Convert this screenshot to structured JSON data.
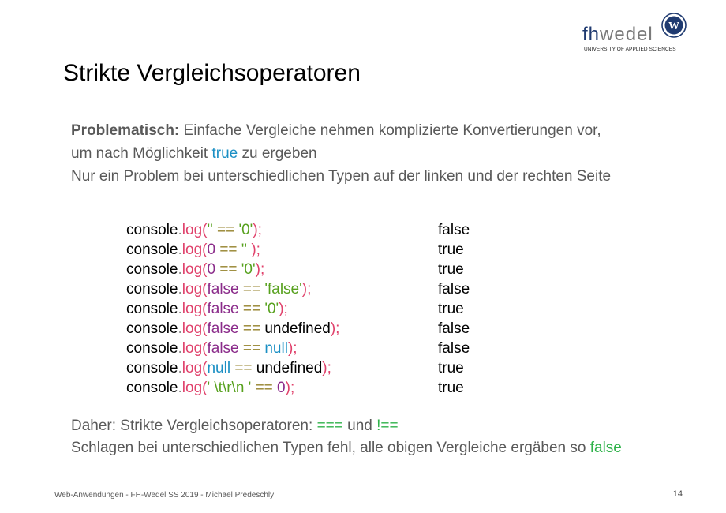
{
  "logo": {
    "fh": "fh",
    "wedel": "wedel",
    "subtitle": "UNIVERSITY OF APPLIED SCIENCES",
    "seal_letter": "W"
  },
  "slide": {
    "title": "Strikte Vergleichsoperatoren",
    "intro": {
      "label": "Problematisch:",
      "line1_text": " Einfache Vergleiche nehmen komplizierte Konvertierungen vor,",
      "line2_pre": "um nach Möglichkeit ",
      "line2_keyword": "true",
      "line2_post": " zu ergeben",
      "line3": "Nur ein Problem bei unterschiedlichen Typen auf der linken und der rechten Seite"
    },
    "code_lines": [
      {
        "tokens": [
          {
            "t": "console",
            "c": "k"
          },
          {
            "t": ".",
            "c": "e"
          },
          {
            "t": "log",
            "c": "m"
          },
          {
            "t": "(",
            "c": "m"
          },
          {
            "t": "''",
            "c": "s"
          },
          {
            "t": " == ",
            "c": "o"
          },
          {
            "t": "'0'",
            "c": "s"
          },
          {
            "t": ");",
            "c": "m"
          }
        ],
        "result": "false"
      },
      {
        "tokens": [
          {
            "t": "console",
            "c": "k"
          },
          {
            "t": ".",
            "c": "e"
          },
          {
            "t": "log",
            "c": "m"
          },
          {
            "t": "(",
            "c": "m"
          },
          {
            "t": "0",
            "c": "n"
          },
          {
            "t": " == ",
            "c": "o"
          },
          {
            "t": "''",
            "c": "s"
          },
          {
            "t": " );",
            "c": "m"
          }
        ],
        "result": "true"
      },
      {
        "tokens": [
          {
            "t": "console",
            "c": "k"
          },
          {
            "t": ".",
            "c": "e"
          },
          {
            "t": "log",
            "c": "m"
          },
          {
            "t": "(",
            "c": "m"
          },
          {
            "t": "0",
            "c": "n"
          },
          {
            "t": " == ",
            "c": "o"
          },
          {
            "t": "'0'",
            "c": "s"
          },
          {
            "t": ");",
            "c": "m"
          }
        ],
        "result": "true"
      },
      {
        "tokens": [
          {
            "t": "console",
            "c": "k"
          },
          {
            "t": ".",
            "c": "e"
          },
          {
            "t": "log",
            "c": "m"
          },
          {
            "t": "(",
            "c": "m"
          },
          {
            "t": "false",
            "c": "n"
          },
          {
            "t": " == ",
            "c": "o"
          },
          {
            "t": "'false'",
            "c": "s"
          },
          {
            "t": ");",
            "c": "m"
          }
        ],
        "result": "false"
      },
      {
        "tokens": [
          {
            "t": "console",
            "c": "k"
          },
          {
            "t": ".",
            "c": "e"
          },
          {
            "t": "log",
            "c": "m"
          },
          {
            "t": "(",
            "c": "m"
          },
          {
            "t": "false",
            "c": "n"
          },
          {
            "t": " == ",
            "c": "o"
          },
          {
            "t": "'0'",
            "c": "s"
          },
          {
            "t": ");",
            "c": "m"
          }
        ],
        "result": "true"
      },
      {
        "tokens": [
          {
            "t": "console",
            "c": "k"
          },
          {
            "t": ".",
            "c": "e"
          },
          {
            "t": "log",
            "c": "m"
          },
          {
            "t": "(",
            "c": "m"
          },
          {
            "t": "false",
            "c": "n"
          },
          {
            "t": " == ",
            "c": "o"
          },
          {
            "t": "undefined",
            "c": "k"
          },
          {
            "t": ");",
            "c": "m"
          }
        ],
        "result": "false"
      },
      {
        "tokens": [
          {
            "t": "console",
            "c": "k"
          },
          {
            "t": ".",
            "c": "e"
          },
          {
            "t": "log",
            "c": "m"
          },
          {
            "t": "(",
            "c": "m"
          },
          {
            "t": "false",
            "c": "n"
          },
          {
            "t": " == ",
            "c": "o"
          },
          {
            "t": "null",
            "c": "b"
          },
          {
            "t": ");",
            "c": "m"
          }
        ],
        "result": "false"
      },
      {
        "tokens": [
          {
            "t": "console",
            "c": "k"
          },
          {
            "t": ".",
            "c": "e"
          },
          {
            "t": "log",
            "c": "m"
          },
          {
            "t": "(",
            "c": "m"
          },
          {
            "t": "null",
            "c": "b"
          },
          {
            "t": " == ",
            "c": "o"
          },
          {
            "t": "undefined",
            "c": "k"
          },
          {
            "t": ");",
            "c": "m"
          }
        ],
        "result": "true"
      },
      {
        "tokens": [
          {
            "t": "console",
            "c": "k"
          },
          {
            "t": ".",
            "c": "e"
          },
          {
            "t": "log",
            "c": "m"
          },
          {
            "t": "(",
            "c": "m"
          },
          {
            "t": "' \\t\\r\\n '",
            "c": "s"
          },
          {
            "t": " == ",
            "c": "o"
          },
          {
            "t": "0",
            "c": "n"
          },
          {
            "t": ");",
            "c": "m"
          }
        ],
        "result": "true"
      }
    ],
    "conclusion": {
      "pre": "Daher: Strikte Vergleichsoperatoren: ",
      "op1": "===",
      "mid": " und ",
      "op2": "!==",
      "line2_pre": "Schlagen bei unterschiedlichen Typen fehl, alle obigen Vergleiche ergäben so ",
      "line2_keyword": "false"
    }
  },
  "footer": {
    "text": "Web-Anwendungen - FH-Wedel SS 2019 - Michael Predeschly",
    "page_number": "14"
  },
  "colors": {
    "title": "#000000",
    "body": "#595959",
    "keyword_true": "#1b8fc4",
    "keyword_green": "#2fb24a",
    "method": "#e0416b",
    "string": "#57a11e",
    "literal": "#8a2b8a",
    "operator": "#94822b"
  }
}
